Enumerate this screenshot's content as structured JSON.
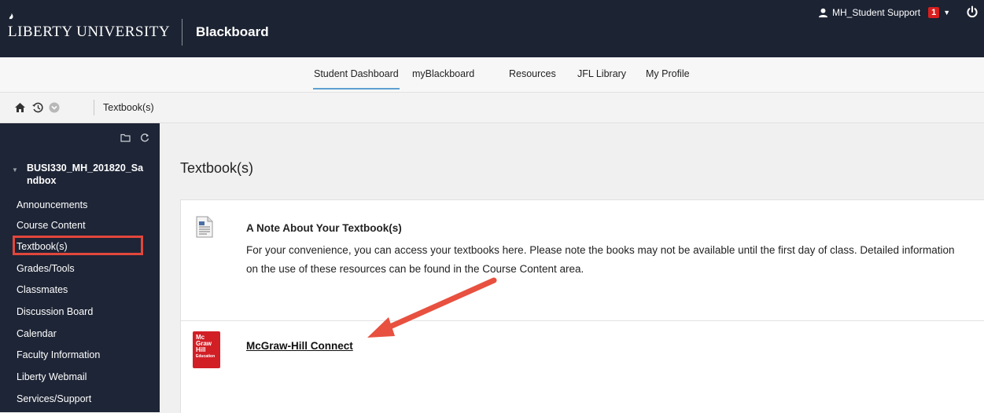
{
  "header": {
    "university_logo": "LIBERTY UNIVERSITY",
    "platform_logo": "Blackboard",
    "user_name": "MH_Student Support",
    "notification_count": "1"
  },
  "tabs": [
    {
      "label": "Student Dashboard",
      "active": true
    },
    {
      "label": "myBlackboard",
      "active": false
    },
    {
      "label": "Resources",
      "active": false
    },
    {
      "label": "JFL Library",
      "active": false
    },
    {
      "label": "My Profile",
      "active": false
    }
  ],
  "breadcrumb": {
    "current": "Textbook(s)"
  },
  "sidebar": {
    "course_title": "BUSI330_MH_201820_Sandbox",
    "items": [
      {
        "label": "Announcements"
      },
      {
        "label": "Course Content"
      },
      {
        "label": "Textbook(s)",
        "highlighted": true
      },
      {
        "label": "Grades/Tools"
      },
      {
        "label": "Classmates"
      },
      {
        "label": "Discussion Board"
      },
      {
        "label": "Calendar"
      },
      {
        "label": "Faculty Information"
      },
      {
        "label": "Liberty Webmail"
      },
      {
        "label": "Services/Support"
      }
    ]
  },
  "content": {
    "page_title": "Textbook(s)",
    "items": [
      {
        "icon": "document-icon",
        "title": "A Note About Your Textbook(s)",
        "body": "For your convenience, you can access your textbooks here. Please note the books may not be available until the first day of class. Detailed information on the use of these resources can be found in the Course Content area."
      },
      {
        "icon": "mcgraw-hill-logo",
        "logo_lines": [
          "Mc",
          "Graw",
          "Hill",
          "Education"
        ],
        "title": "McGraw-Hill Connect"
      }
    ]
  },
  "colors": {
    "header_bg": "#1c2333",
    "sidebar_bg": "#1e2536",
    "highlight_box": "#e2473c",
    "annotation_arrow": "#e8503f",
    "notification_badge": "#d81e1e",
    "mcgraw_hill_red": "#d21f26",
    "active_tab_underline": "#5fa0d0"
  }
}
